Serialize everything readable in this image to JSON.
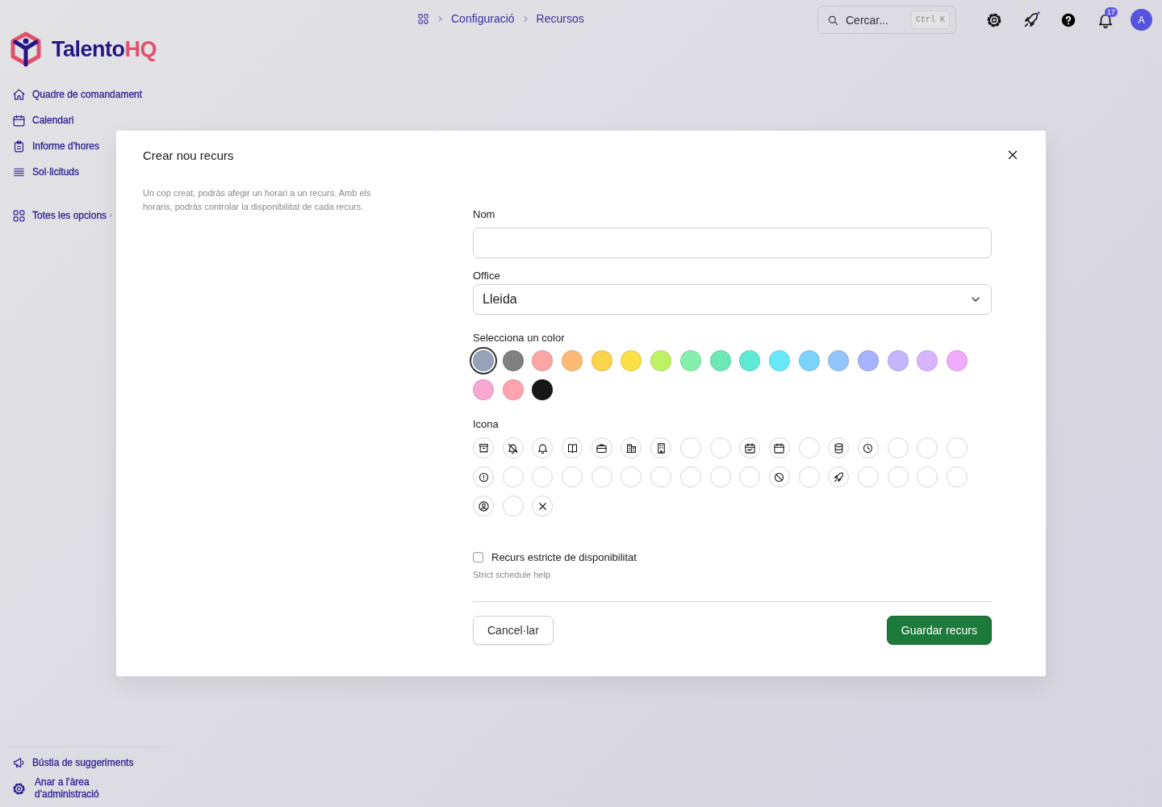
{
  "logo": {
    "name": "Talento",
    "accent": "HQ"
  },
  "breadcrumb": [
    "Configuració",
    "Recursos"
  ],
  "search": {
    "placeholder": "Cercar...",
    "shortcut": "Ctrl K"
  },
  "header": {
    "notification_count": "17",
    "avatar": "A"
  },
  "sidebar": {
    "items": [
      {
        "kind": "home",
        "label": "Quadre de comandament"
      },
      {
        "kind": "calendar",
        "label": "Calendari"
      },
      {
        "kind": "clipboard",
        "label": "Informe d'hores"
      },
      {
        "kind": "list",
        "label": "Sol·licituds"
      },
      {
        "kind": "grid",
        "label": "Totes les opcions"
      }
    ],
    "bottom_items": [
      {
        "kind": "megaphone",
        "label": "Bústia de suggeriments"
      },
      {
        "kind": "gear",
        "label": "Anar a l'àrea d'administració"
      }
    ]
  },
  "modal": {
    "title": "Crear nou recurs",
    "description": "Un cop creat, podràs afegir un horari a un recurs. Amb els horaris, podràs controlar la disponibilitat de cada recurs.",
    "name_field": {
      "label": "Nom"
    },
    "office_field": {
      "label": "Office",
      "value": "Lleida"
    },
    "color_label": "Selecciona un color",
    "colors": [
      {
        "color": "#94a3b8",
        "selected": true
      },
      {
        "color": "#808080",
        "selected": false
      },
      {
        "color": "#fca5a5",
        "selected": false
      },
      {
        "color": "#fdba74",
        "selected": false
      },
      {
        "color": "#fcd34d",
        "selected": false
      },
      {
        "color": "#fde047",
        "selected": false
      },
      {
        "color": "#bef264",
        "selected": false
      },
      {
        "color": "#86efac",
        "selected": false
      },
      {
        "color": "#6ee7b7",
        "selected": false
      },
      {
        "color": "#5eead4",
        "selected": false
      },
      {
        "color": "#67e8f9",
        "selected": false
      },
      {
        "color": "#7dd3fc",
        "selected": false
      },
      {
        "color": "#93c5fd",
        "selected": false
      },
      {
        "color": "#a5b4fc",
        "selected": false
      },
      {
        "color": "#c4b5fd",
        "selected": false
      },
      {
        "color": "#d8b4fe",
        "selected": false
      },
      {
        "color": "#f0abfc",
        "selected": false
      },
      {
        "color": "#f9a8d4",
        "selected": false
      },
      {
        "color": "#fda4af",
        "selected": false
      },
      {
        "color": "#171717",
        "selected": false
      }
    ],
    "icon_label": "Icona",
    "icons": [
      {
        "kind": "archive"
      },
      {
        "kind": "bell-off"
      },
      {
        "kind": "bell"
      },
      {
        "kind": "book"
      },
      {
        "kind": "briefcase"
      },
      {
        "kind": "buildings"
      },
      {
        "kind": "building"
      },
      {
        "kind": "blank"
      },
      {
        "kind": "blank"
      },
      {
        "kind": "calendar-dots"
      },
      {
        "kind": "calendar"
      },
      {
        "kind": "blank"
      },
      {
        "kind": "database"
      },
      {
        "kind": "clock"
      },
      {
        "kind": "blank"
      },
      {
        "kind": "blank"
      },
      {
        "kind": "blank"
      },
      {
        "kind": "alert"
      },
      {
        "kind": "blank"
      },
      {
        "kind": "blank"
      },
      {
        "kind": "blank"
      },
      {
        "kind": "blank"
      },
      {
        "kind": "blank"
      },
      {
        "kind": "blank"
      },
      {
        "kind": "blank"
      },
      {
        "kind": "blank"
      },
      {
        "kind": "blank"
      },
      {
        "kind": "ban"
      },
      {
        "kind": "blank"
      },
      {
        "kind": "rocket"
      },
      {
        "kind": "blank"
      },
      {
        "kind": "blank"
      },
      {
        "kind": "blank"
      },
      {
        "kind": "blank"
      },
      {
        "kind": "user-circle"
      },
      {
        "kind": "blank"
      },
      {
        "kind": "x"
      }
    ],
    "strict": {
      "label": "Recurs estricte de disponibilitat",
      "checked": false,
      "help": "Strict schedule help"
    },
    "cancel_button": "Cancel·lar",
    "save_button": "Guardar recurs"
  }
}
